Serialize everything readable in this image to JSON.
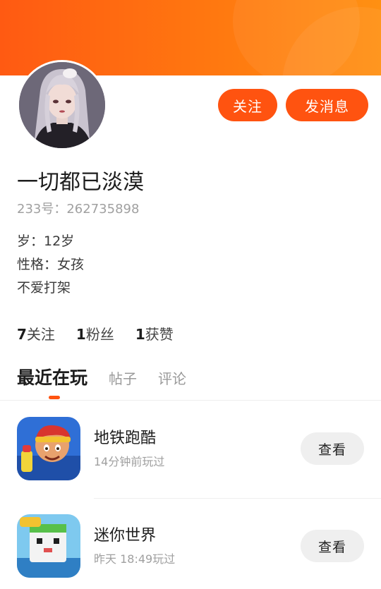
{
  "colors": {
    "accent": "#ff5310",
    "banner": "#ff7a10"
  },
  "profile": {
    "avatar_icon": "anime-girl-avatar",
    "name": "一切都已淡漠",
    "uid": "233号：262735898",
    "info": [
      "岁：12岁",
      "性格：女孩",
      "不爱打架"
    ]
  },
  "actions": {
    "follow": "关注",
    "message": "发消息"
  },
  "stats": [
    {
      "count": "7",
      "label": "关注"
    },
    {
      "count": "1",
      "label": "粉丝"
    },
    {
      "count": "1",
      "label": "获赞"
    }
  ],
  "tabs": [
    {
      "label": "最近在玩",
      "active": true
    },
    {
      "label": "帖子",
      "active": false
    },
    {
      "label": "评论",
      "active": false
    }
  ],
  "games": [
    {
      "name": "地铁跑酷",
      "time": "14分钟前玩过",
      "button": "查看",
      "icon": "subway-surfers-icon"
    },
    {
      "name": "迷你世界",
      "time": "昨天 18:49玩过",
      "button": "查看",
      "icon": "mini-world-icon"
    }
  ]
}
